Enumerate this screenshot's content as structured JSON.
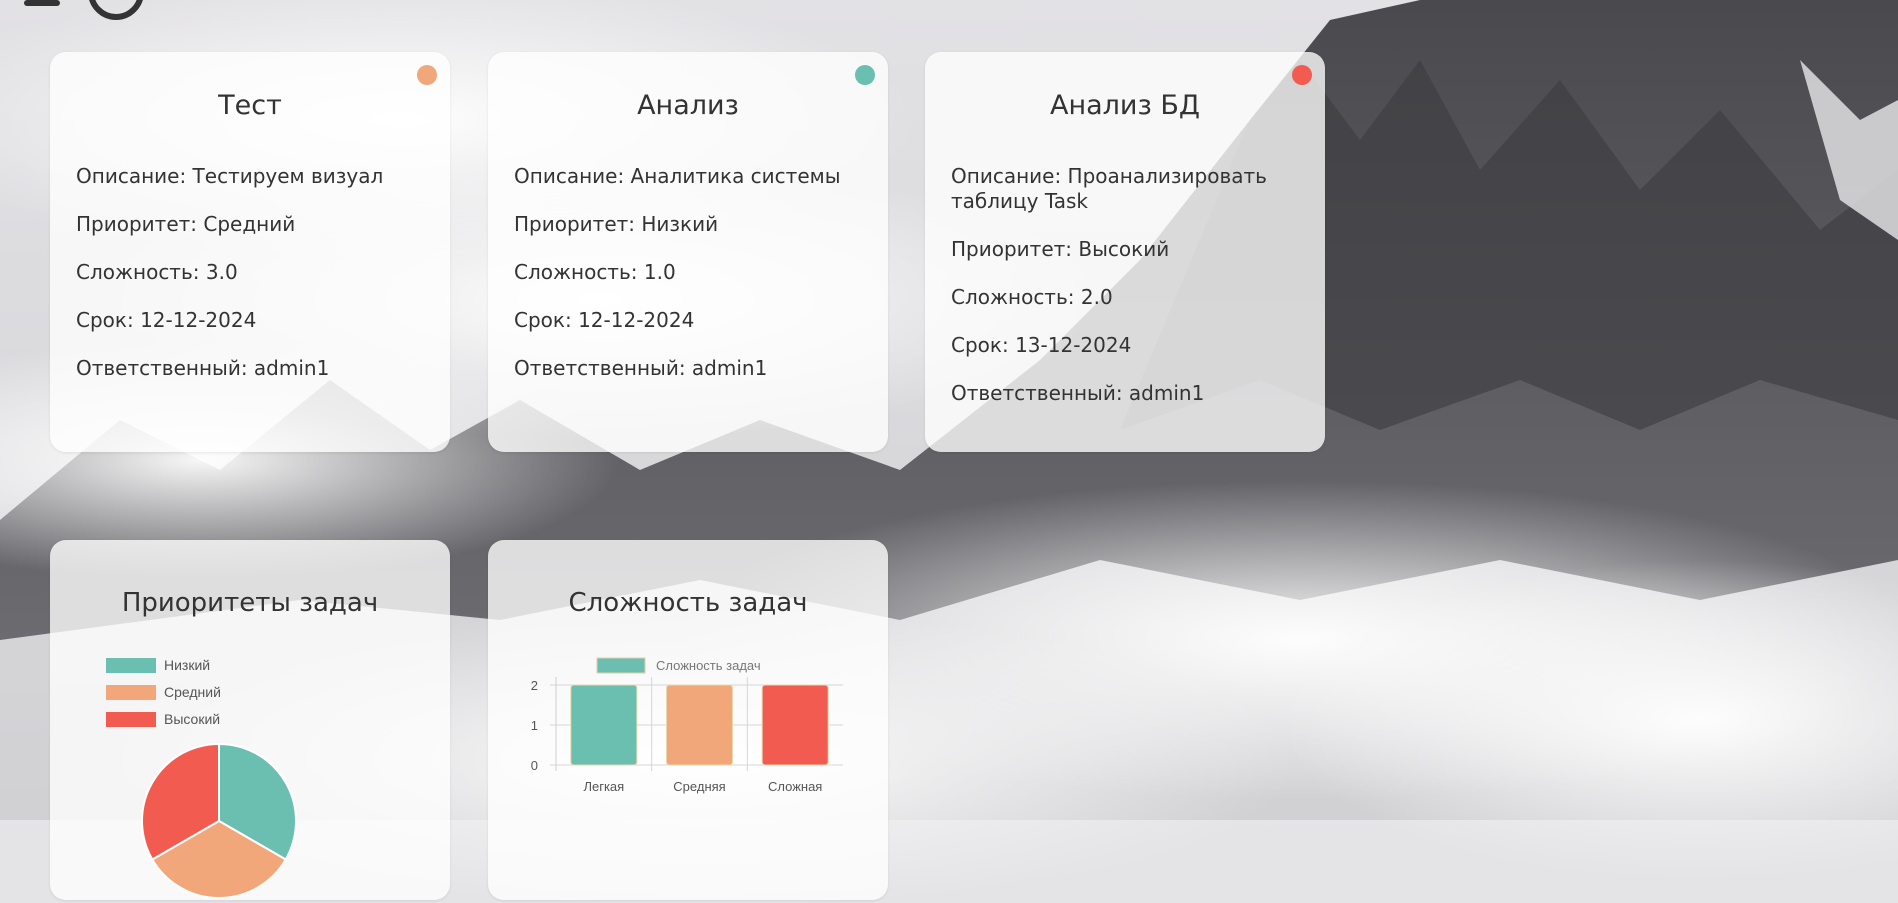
{
  "colors": {
    "low": "#6bbfb0",
    "medium": "#f2a77a",
    "high": "#f25c50",
    "card_bg": "rgba(255,255,255,0.78)"
  },
  "header": {
    "menu_icon": "hamburger-icon",
    "logo_icon": "circle-logo-icon"
  },
  "tasks": [
    {
      "title": "Тест",
      "status_color": "#f2a77a",
      "description_label": "Описание:",
      "description": "Тестируем визуал",
      "priority_label": "Приоритет:",
      "priority": "Средний",
      "complexity_label": "Сложность:",
      "complexity": "3.0",
      "due_label": "Срок:",
      "due": "12-12-2024",
      "assignee_label": "Ответственный:",
      "assignee": "admin1"
    },
    {
      "title": "Анализ",
      "status_color": "#6bbfb0",
      "description_label": "Описание:",
      "description": "Аналитика системы",
      "priority_label": "Приоритет:",
      "priority": "Низкий",
      "complexity_label": "Сложность:",
      "complexity": "1.0",
      "due_label": "Срок:",
      "due": "12-12-2024",
      "assignee_label": "Ответственный:",
      "assignee": "admin1"
    },
    {
      "title": "Анализ БД",
      "status_color": "#f25c50",
      "description_label": "Описание:",
      "description": "Проанализировать таблицу Task",
      "priority_label": "Приоритет:",
      "priority": "Высокий",
      "complexity_label": "Сложность:",
      "complexity": "2.0",
      "due_label": "Срок:",
      "due": "13-12-2024",
      "assignee_label": "Ответственный:",
      "assignee": "admin1"
    }
  ],
  "charts": {
    "priority_title": "Приоритеты задач",
    "complexity_title": "Сложность задач"
  },
  "chart_data": [
    {
      "type": "pie",
      "title": "Приоритеты задач",
      "legend_position": "top-left",
      "categories": [
        "Низкий",
        "Средний",
        "Высокий"
      ],
      "values": [
        1,
        1,
        1
      ],
      "colors": [
        "#6bbfb0",
        "#f2a77a",
        "#f25c50"
      ]
    },
    {
      "type": "bar",
      "title": "Сложность задач",
      "legend_position": "top",
      "categories": [
        "Легкая",
        "Средняя",
        "Сложная"
      ],
      "series": [
        {
          "name": "Сложность задач",
          "values": [
            2,
            2,
            2
          ]
        }
      ],
      "colors": [
        "#6bbfb0",
        "#f2a77a",
        "#f25c50"
      ],
      "ylim": [
        0,
        2
      ],
      "yticks": [
        "0",
        "1",
        "2"
      ],
      "grid": true
    }
  ]
}
